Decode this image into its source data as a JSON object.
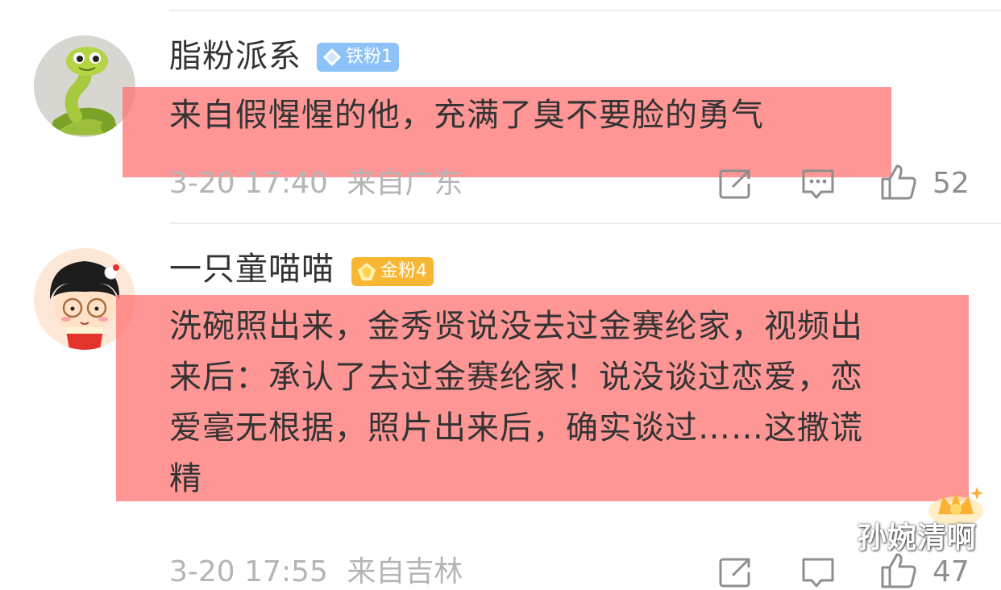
{
  "comments": [
    {
      "username": "脂粉派系",
      "badge": {
        "label": "铁粉1",
        "color": "#8cc2f7",
        "icon": "diamond-icon"
      },
      "text": "来自假惺惺的他，充满了臭不要脸的勇气",
      "time": "3-20 17:40",
      "location": "来自广东",
      "likes": "52",
      "avatar": "snake-avatar"
    },
    {
      "username": "一只童喵喵",
      "badge": {
        "label": "金粉4",
        "color": "#f7b733",
        "icon": "diamond-icon"
      },
      "text_lines": [
        "洗碗照出来，金秀贤说没去过金赛纶家，视频出",
        "来后：承认了去过金赛纶家！说没谈过恋爱，恋",
        "爱毫无根据，照片出来后，确实谈过……这撒谎",
        "精"
      ],
      "time": "3-20 17:55",
      "location": "来自吉林",
      "likes": "47",
      "avatar": "cartoon-girl-avatar"
    }
  ],
  "watermark": "孙婉清啊",
  "colors": {
    "highlight": "#ff6e6e",
    "text": "#333333",
    "meta": "#b5b5b5"
  }
}
